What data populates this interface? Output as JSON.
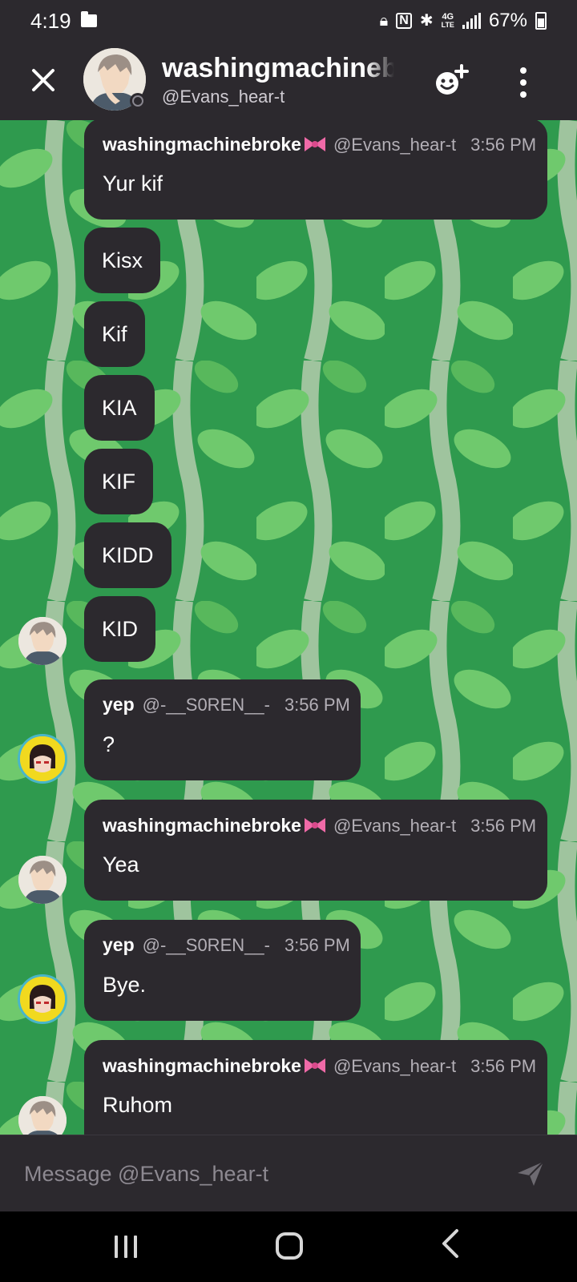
{
  "status_bar": {
    "time": "4:19",
    "network": "4G",
    "network_sub": "LTE",
    "battery": "67%"
  },
  "header": {
    "title": "washingmachinebroke",
    "subtitle": "@Evans_hear-t",
    "icons": {
      "close": "close-icon",
      "add_friend": "add-friend-icon",
      "more": "more-vertical-icon"
    }
  },
  "messages": [
    {
      "author": "washingmachinebroke",
      "handle": "@Evans_hear-t",
      "time": "3:56 PM",
      "text": "Yur kif"
    },
    {
      "text": "Kisx"
    },
    {
      "text": "Kif"
    },
    {
      "text": "KIA"
    },
    {
      "text": "KIF"
    },
    {
      "text": "KIDD"
    },
    {
      "text": "KID"
    },
    {
      "author": "yep",
      "handle": "@-__S0REN__-",
      "time": "3:56 PM",
      "text": "?"
    },
    {
      "author": "washingmachinebroke",
      "handle": "@Evans_hear-t",
      "time": "3:56 PM",
      "text": "Yea"
    },
    {
      "author": "yep",
      "handle": "@-__S0REN__-",
      "time": "3:56 PM",
      "text": "Bye."
    },
    {
      "author": "washingmachinebroke",
      "handle": "@Evans_hear-t",
      "time": "3:56 PM",
      "text": "Ruhom"
    }
  ],
  "composer": {
    "placeholder": "Message @Evans_hear-t",
    "send_icon": "send-icon"
  },
  "colors": {
    "bubble": "#2c292e",
    "bar": "#2c292e",
    "wallpaper_green": "#2f9a4e",
    "leaf_light": "#7fd47c",
    "bow_pink": "#f06aa8"
  }
}
